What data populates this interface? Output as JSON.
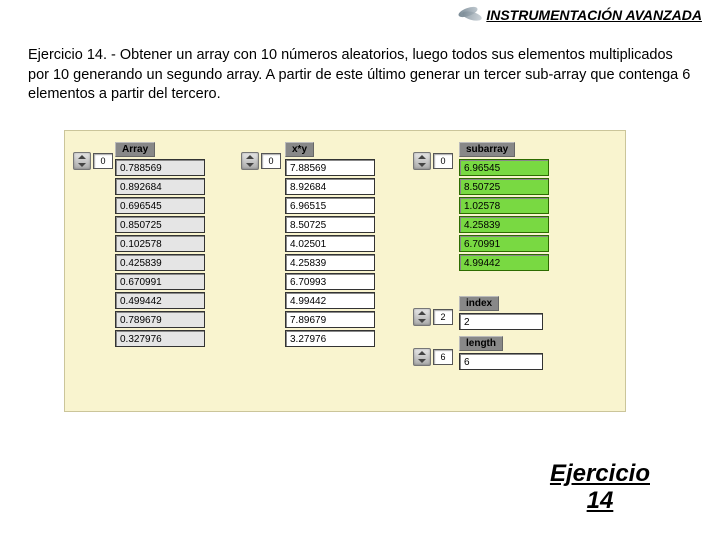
{
  "header": {
    "title": "INSTRUMENTACIÓN AVANZADA"
  },
  "exercise": {
    "text": "Ejercicio 14. - Obtener un array con 10 números aleatorios, luego todos sus elementos multiplicados por 10 generando un segundo array. A partir de este último generar un tercer sub-array que contenga 6 elementos a partir del tercero."
  },
  "columns": {
    "array": {
      "label": "Array",
      "spinner": "0",
      "cells": [
        "0.788569",
        "0.892684",
        "0.696545",
        "0.850725",
        "0.102578",
        "0.425839",
        "0.670991",
        "0.499442",
        "0.789679",
        "0.327976"
      ]
    },
    "xy": {
      "label": "x*y",
      "spinner": "0",
      "cells": [
        "7.88569",
        "8.92684",
        "6.96515",
        "8.50725",
        "4.02501",
        "4.25839",
        "6.70993",
        "4.99442",
        "7.89679",
        "3.27976"
      ]
    },
    "subarray": {
      "label": "subarray",
      "spinner": "0",
      "cells": [
        "6.96545",
        "8.50725",
        "1.02578",
        "4.25839",
        "6.70991",
        "4.99442"
      ]
    }
  },
  "mini": {
    "index": {
      "label": "index",
      "spinner": "2",
      "value": "2"
    },
    "length": {
      "label": "length",
      "spinner": "6",
      "value": "6"
    }
  },
  "link": {
    "line1": "Ejercicio",
    "line2": "14"
  }
}
